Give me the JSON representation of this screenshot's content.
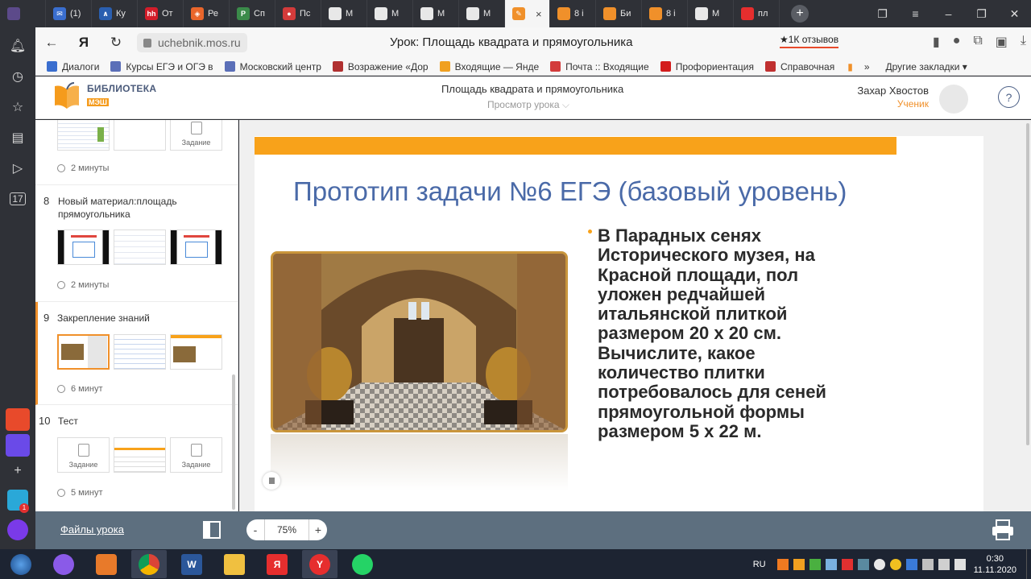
{
  "browser": {
    "tabs": [
      {
        "label": "",
        "color": "#5c4a8a",
        "glyph": ""
      },
      {
        "label": "(1)",
        "color": "#3a6ecf",
        "glyph": "✉"
      },
      {
        "label": "Ку",
        "color": "#2a5fb0",
        "glyph": "∧"
      },
      {
        "label": "От",
        "color": "#d31d2a",
        "glyph": "hh"
      },
      {
        "label": "Ре",
        "color": "#e9662b",
        "glyph": "◈"
      },
      {
        "label": "Сп",
        "color": "#3b8b4a",
        "glyph": "P"
      },
      {
        "label": "Пс",
        "color": "#d33b3b",
        "glyph": "●"
      },
      {
        "label": "М",
        "color": "#e8e8e8",
        "glyph": ""
      },
      {
        "label": "М",
        "color": "#e8e8e8",
        "glyph": ""
      },
      {
        "label": "М",
        "color": "#e8e8e8",
        "glyph": ""
      },
      {
        "label": "М",
        "color": "#e8e8e8",
        "glyph": ""
      }
    ],
    "active_tab_close": "×",
    "tabs_after": [
      {
        "label": "8 і",
        "color": "#f0902a"
      },
      {
        "label": "Би",
        "color": "#f0902a"
      },
      {
        "label": "8 і",
        "color": "#f0902a"
      },
      {
        "label": "М",
        "color": "#e8e8e8"
      },
      {
        "label": "пл",
        "color": "#e62e2e"
      }
    ],
    "new_tab": "+",
    "url": "uchebnik.mos.ru",
    "page_title": "Урок: Площадь квадрата и прямоугольника",
    "reviews": "★1К отзывов",
    "bookmarks": [
      {
        "label": "Диалоги",
        "color": "#3a6ecf"
      },
      {
        "label": "Курсы ЕГЭ и ОГЭ в",
        "color": "#5b6fb8"
      },
      {
        "label": "Московский центр",
        "color": "#5b6fb8"
      },
      {
        "label": "Возражение «Дор",
        "color": "#b03030"
      },
      {
        "label": "Входящие — Янде",
        "color": "#f0a020"
      },
      {
        "label": "Почта :: Входящие",
        "color": "#d33b3b"
      },
      {
        "label": "Профориентация",
        "color": "#d31d1d"
      },
      {
        "label": "Справочная",
        "color": "#c03030"
      }
    ],
    "more_bookmarks": "»",
    "other_bookmarks": "Другие закладки ▾"
  },
  "app": {
    "logo_line1": "БИБЛИОТЕКА",
    "logo_line2": "МЭШ",
    "lesson_title": "Площадь квадрата и прямоугольника",
    "lesson_subtitle": "Просмотр урока",
    "user_name": "Захар Хвостов",
    "user_role": "Ученик",
    "help": "?"
  },
  "sidebar": {
    "first_duration": "2 минуты",
    "first_task_label": "Задание",
    "sections": [
      {
        "num": "8",
        "title": "Новый материал:площадь прямоугольника",
        "duration": "2 минуты"
      },
      {
        "num": "9",
        "title": "Закрепление знаний",
        "duration": "6 минут"
      },
      {
        "num": "10",
        "title": "Тест",
        "duration": "5 минут",
        "task_label": "Задание"
      }
    ]
  },
  "slide": {
    "title": "Прототип задачи №6 ЕГЭ (базовый уровень)",
    "body": "В Парадных сенях Исторического музея, на Красной площади, пол уложен редчайшей итальянской плиткой размером 20 х 20 см. Вычислите, какое количество плитки потребовалось для сеней прямоугольной формы размером 5 х 22 м."
  },
  "bottom": {
    "files_link": "Файлы урока",
    "zoom_minus": "-",
    "zoom_value": "75%",
    "zoom_plus": "+"
  },
  "taskbar": {
    "lang": "RU",
    "time": "0:30",
    "date": "11.11.2020",
    "mail_badge": "1"
  },
  "colors": {
    "accent_orange": "#f8a21a",
    "title_blue": "#4a6aa8",
    "bottom_bar": "#5d6f7f"
  }
}
